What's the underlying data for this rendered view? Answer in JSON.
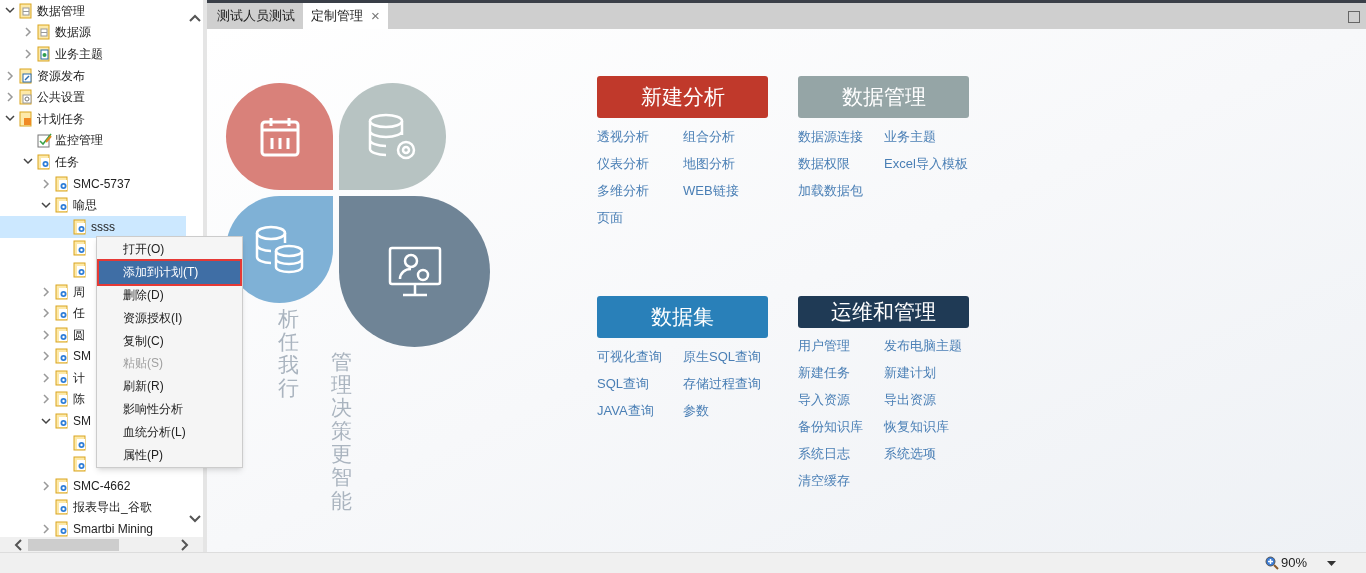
{
  "tree": [
    {
      "label": "数据管理",
      "kind": "db",
      "expanded": true,
      "selected": false,
      "children": [
        {
          "label": "数据源",
          "kind": "db",
          "expanded": false,
          "selected": false
        },
        {
          "label": "业务主题",
          "kind": "topic",
          "expanded": false,
          "selected": false
        }
      ]
    },
    {
      "label": "资源发布",
      "kind": "publish",
      "expanded": false,
      "selected": false
    },
    {
      "label": "公共设置",
      "kind": "settings",
      "expanded": false,
      "selected": false
    },
    {
      "label": "计划任务",
      "kind": "schedule",
      "expanded": true,
      "selected": false,
      "children": [
        {
          "label": "监控管理",
          "kind": "monitor",
          "selected": false
        },
        {
          "label": "任务",
          "kind": "task",
          "expanded": true,
          "selected": false,
          "children": [
            {
              "label": "SMC-5737",
              "kind": "task",
              "expanded": false,
              "selected": false
            },
            {
              "label": "喻思",
              "kind": "task",
              "expanded": true,
              "selected": false,
              "children": [
                {
                  "label": "ssss",
                  "kind": "task",
                  "selected": true
                },
                {
                  "kind": "task",
                  "selected": false
                },
                {
                  "kind": "task",
                  "selected": false
                }
              ]
            },
            {
              "label": "周",
              "kind": "task",
              "expanded": false,
              "selected": false
            },
            {
              "label": "任",
              "kind": "task",
              "expanded": false,
              "selected": false
            },
            {
              "label": "圆",
              "kind": "task",
              "expanded": false,
              "selected": false
            },
            {
              "label": "SM",
              "kind": "task",
              "expanded": false,
              "selected": false
            },
            {
              "label": "计",
              "kind": "task",
              "expanded": false,
              "selected": false
            },
            {
              "label": "陈",
              "kind": "task",
              "expanded": false,
              "selected": false
            },
            {
              "label": "SM",
              "kind": "task",
              "expanded": true,
              "selected": false,
              "children": [
                {
                  "kind": "task",
                  "selected": false
                },
                {
                  "kind": "task",
                  "selected": false
                }
              ]
            },
            {
              "label": "SMC-4662",
              "kind": "task",
              "expanded": false,
              "selected": false
            },
            {
              "label": "报表导出_谷歌",
              "kind": "task",
              "selected": false
            },
            {
              "label": "Smartbi Mining",
              "kind": "task",
              "expanded": false,
              "selected": false
            }
          ]
        }
      ]
    }
  ],
  "context_menu": [
    {
      "label": "打开(O)",
      "disabled": false,
      "selected": false
    },
    {
      "label": "添加到计划(T)",
      "disabled": false,
      "selected": true
    },
    {
      "label": "删除(D)",
      "disabled": false,
      "selected": false
    },
    {
      "label": "资源授权(I)",
      "disabled": false,
      "selected": false
    },
    {
      "label": "复制(C)",
      "disabled": false,
      "selected": false
    },
    {
      "label": "粘贴(S)",
      "disabled": true,
      "selected": false
    },
    {
      "label": "刷新(R)",
      "disabled": false,
      "selected": false
    },
    {
      "label": "影响性分析",
      "disabled": false,
      "selected": false
    },
    {
      "label": "血统分析(L)",
      "disabled": false,
      "selected": false
    },
    {
      "label": "属性(P)",
      "disabled": false,
      "selected": false
    }
  ],
  "tabs": [
    {
      "label": "测试人员测试",
      "selected": false,
      "closable": false
    },
    {
      "label": "定制管理",
      "selected": true,
      "closable": true,
      "close_glyph": "×"
    }
  ],
  "slogans": [
    "析任我行",
    "管理决策更智能"
  ],
  "sections": [
    {
      "title": "新建分析",
      "color": "#c0392b",
      "links": [
        "透视分析",
        "组合分析",
        "仪表分析",
        "地图分析",
        "多维分析",
        "WEB链接",
        "页面"
      ]
    },
    {
      "title": "数据管理",
      "color": "#95a5a6",
      "links": [
        "数据源连接",
        "业务主题",
        "数据权限",
        "Excel导入模板",
        "加载数据包"
      ]
    },
    {
      "title": "数据集",
      "color": "#2980b9",
      "links": [
        "可视化查询",
        "原生SQL查询",
        "SQL查询",
        "存储过程查询",
        "JAVA查询",
        "参数"
      ]
    },
    {
      "title": "运维和管理",
      "color": "#1f3a55",
      "links": [
        "用户管理",
        "发布电脑主题",
        "新建任务",
        "新建计划",
        "导入资源",
        "导出资源",
        "备份知识库",
        "恢复知识库",
        "系统日志",
        "系统选项",
        "清空缓存"
      ]
    }
  ],
  "status_bar": {
    "zoom": "90%"
  }
}
